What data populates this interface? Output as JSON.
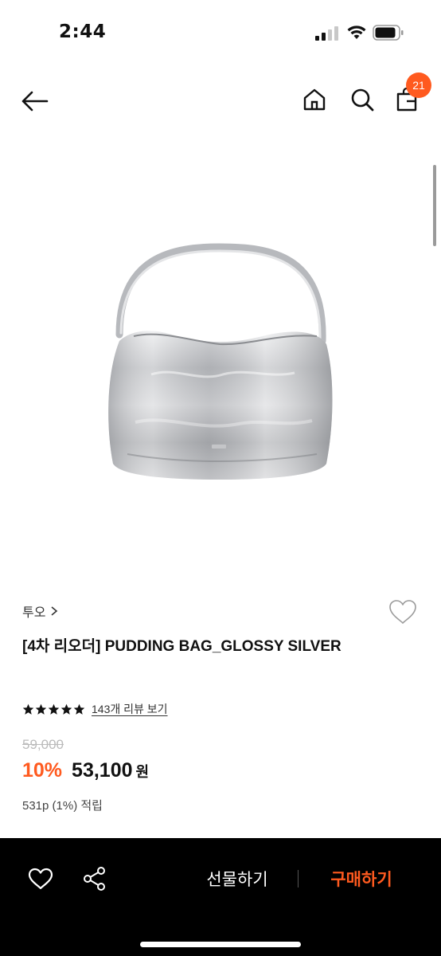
{
  "status_bar": {
    "time": "2:44"
  },
  "header": {
    "cart_count": "21",
    "icons": [
      "arrow-left-icon",
      "home-icon",
      "search-icon",
      "bag-icon"
    ]
  },
  "product": {
    "image_icon": "silver-handbag-image",
    "brand": "투오",
    "title": "[4차 리오더] PUDDING BAG_GLOSSY SILVER",
    "rating_stars": 5,
    "review_link": "143개 리뷰 보기",
    "original_price": "59,000",
    "discount": "10%",
    "sale_price": "53,100",
    "currency": "원",
    "points": "531p (1%) 적립"
  },
  "bottom_bar": {
    "gift_label": "선물하기",
    "buy_label": "구매하기"
  },
  "colors": {
    "accent": "#ff5a1f",
    "bar_bg": "#000000"
  }
}
